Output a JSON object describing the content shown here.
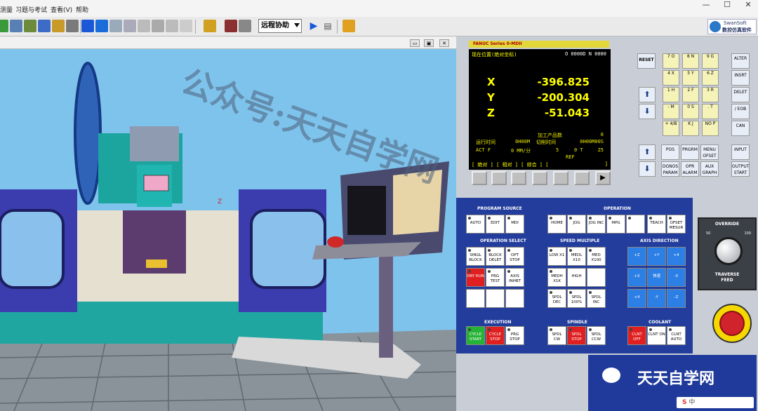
{
  "menubar": {
    "items": [
      "测量",
      "习题与考试",
      "查看(V)",
      "帮助"
    ]
  },
  "toolbar": {
    "mode_select": "远程协助"
  },
  "window_controls": {
    "minimize": "—",
    "maximize": "☐",
    "close": "✕"
  },
  "logo": {
    "brand": "SwanSoft",
    "subtitle": "数控仿真软件"
  },
  "viewport": {
    "buttons": [
      "▭",
      "▣",
      "✕"
    ]
  },
  "fanuc": {
    "model": "FANUC  Series  0-MDII",
    "title_left": "现在位置(绝对坐标)",
    "title_right": "O 0000D  N 0000",
    "axes": [
      {
        "label": "X",
        "value": "-396.825"
      },
      {
        "label": "Y",
        "value": "-200.304"
      },
      {
        "label": "Z",
        "value": "-51.043"
      }
    ],
    "parts_label": "加工产品数",
    "parts_value": "0",
    "run_time_label": "运行时间",
    "run_time_value": "0H00M",
    "cut_time_label": "切削时间",
    "cut_time_value": "0H00M00S",
    "actf_label": "ACT F",
    "actf_value": "0 MM/分",
    "s_value": "5",
    "t_value": "0  T",
    "t_num": "25",
    "ref": "REF",
    "softkeys": [
      "[ 绝对 ]",
      "[ 相对 ]",
      "[ 综合 ]",
      "[",
      "]"
    ]
  },
  "mdi_keys": [
    [
      "7 O",
      "8 N",
      "9 G"
    ],
    [
      "4 X",
      "5 Y",
      "6 Z"
    ],
    [
      "1 H",
      "2 F",
      "3 R"
    ],
    [
      "- M",
      "0 S",
      ". T"
    ],
    [
      "+ 4/B",
      "K J",
      "NO P"
    ]
  ],
  "function_keys": {
    "reset": "RESET",
    "alter": "ALTER",
    "insrt": "INSRT",
    "delet": "DELET",
    "eob": "/ EOB",
    "can": "CAN",
    "input": "INPUT",
    "output": "OUTPUT START",
    "pos": "POS",
    "prgrm": "PRGRM",
    "menu": "MENU OFSET",
    "dgnos": "DGNOS PARAM",
    "opr": "OPR ALARM",
    "aux": "AUX GRAPH"
  },
  "operation_panel": {
    "program_source": "PROGRAM SOURCE",
    "operation": "OPERATION",
    "operation_select": "OPERATION SELECT",
    "speed_multiple": "SPEED MULTIPLE",
    "axis_direction": "AXIS DIRECTION",
    "execution": "EXECUTION",
    "spindle": "SPINDLE",
    "coolant": "COOLANT",
    "mode_keys": [
      "AUTO",
      "EDIT",
      "MDI",
      "HOME",
      "JOG",
      "JOG INC",
      "MPG",
      "",
      "TEACH",
      "OFSET MESUR"
    ],
    "select_keys": [
      "SINGL BLOCK",
      "BLOCK DELET",
      "OPT STOP",
      "DRY RUN",
      "PRG TEST",
      "AXIS INHBT"
    ],
    "speed_keys": [
      "LOW X1",
      "MEDL X10",
      "MED X100",
      "MEDH X1K",
      "HIGH",
      "",
      "SPDL DEC",
      "SPDL 100%",
      "SPDL INC"
    ],
    "axis_keys": [
      "+Z",
      "+Y",
      "+4",
      "+X",
      "快速",
      "-X",
      "+4",
      "-Y",
      "-Z"
    ],
    "exec_keys": [
      "CYCLE START",
      "CYCLE STOP",
      "PRG STOP"
    ],
    "spindle_keys": [
      "SPDL CW",
      "SPDL STOP",
      "SPDL CCW"
    ],
    "coolant_keys": [
      "CLNT OFF",
      "CLNT ON",
      "CLNT AUTO"
    ]
  },
  "override": {
    "title": "OVERRIDE",
    "min": "50",
    "max": "100",
    "caption": "TRAVERSE FEED"
  },
  "watermark": {
    "main": "公众号:天天自学网",
    "brand": "天天自学网",
    "ime": "中"
  },
  "scene": {
    "axis_marker": "Z"
  }
}
